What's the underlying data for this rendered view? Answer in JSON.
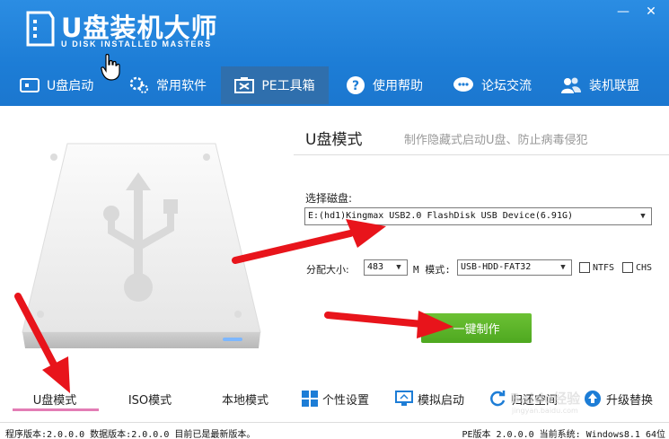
{
  "app": {
    "title": "U盘装机大师",
    "subtitle": "U DISK INSTALLED MASTERS",
    "brand_color": "#1d7dd6",
    "window_controls": {
      "minimize": "—",
      "close": "✕"
    }
  },
  "nav": {
    "items": [
      {
        "label": "U盘启动",
        "icon": "usb-icon",
        "active": false
      },
      {
        "label": "常用软件",
        "icon": "software-icon",
        "active": false
      },
      {
        "label": "PE工具箱",
        "icon": "toolbox-icon",
        "active": true
      },
      {
        "label": "使用帮助",
        "icon": "help-icon",
        "active": false
      },
      {
        "label": "论坛交流",
        "icon": "chat-icon",
        "active": false
      },
      {
        "label": "装机联盟",
        "icon": "users-icon",
        "active": false
      }
    ]
  },
  "main": {
    "mode_title": "U盘模式",
    "mode_desc": "制作隐藏式启动U盘、防止病毒侵犯",
    "disk_label": "选择磁盘:",
    "disk_value": "E:(hd1)Kingmax USB2.0 FlashDisk USB Device(6.91G)",
    "alloc_label": "分配大小:",
    "alloc_value": "483",
    "m_label": "M 模式:",
    "mode_value": "USB-HDD-FAT32",
    "ntfs_label": "NTFS",
    "chs_label": "CHS",
    "make_button": "一键制作",
    "button_color": "#5cb526"
  },
  "tabs": {
    "udisk": "U盘模式",
    "iso": "ISO模式",
    "local": "本地模式",
    "personal": "个性设置",
    "simulate": "模拟启动",
    "restore": "归还空间",
    "upgrade": "升级替换"
  },
  "status": {
    "left": "程序版本:2.0.0.0  数据版本:2.0.0.0 目前已是最新版本。",
    "right": "PE版本 2.0.0.0 当前系统: Windows8.1 64位"
  },
  "watermark": "jingyan.baidu.com"
}
